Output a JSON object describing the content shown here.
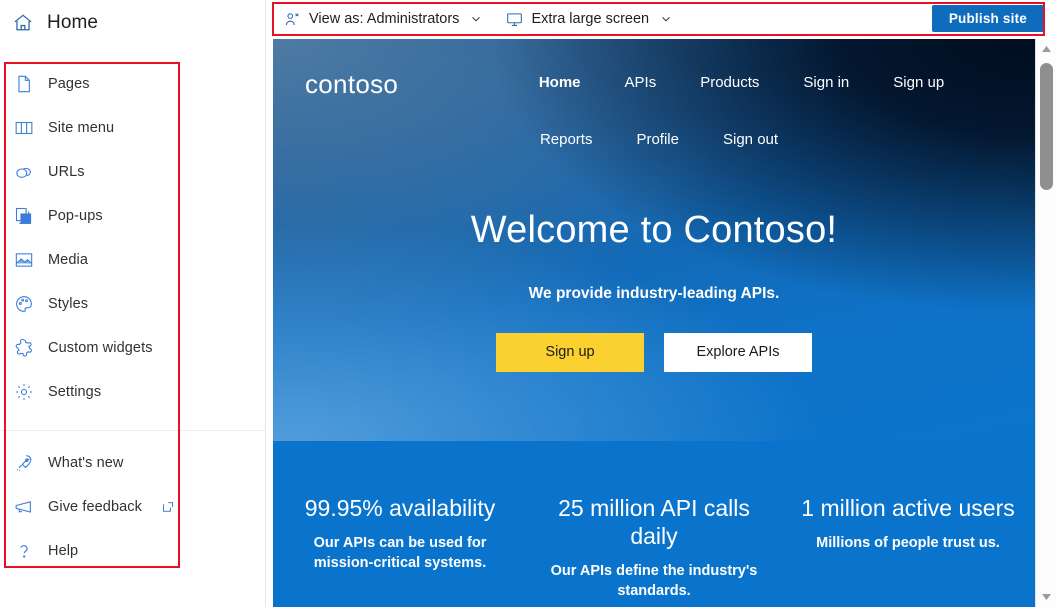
{
  "page_title": "Home",
  "sidebar": {
    "header": {
      "icon": "home-icon",
      "label": "Home"
    },
    "primary_items": [
      {
        "label": "Pages",
        "icon": "page-icon"
      },
      {
        "label": "Site menu",
        "icon": "menu-book-icon"
      },
      {
        "label": "URLs",
        "icon": "link-icon"
      },
      {
        "label": "Pop-ups",
        "icon": "copy-icon"
      },
      {
        "label": "Media",
        "icon": "image-icon"
      },
      {
        "label": "Styles",
        "icon": "palette-icon"
      },
      {
        "label": "Custom widgets",
        "icon": "puzzle-icon"
      },
      {
        "label": "Settings",
        "icon": "gear-icon"
      }
    ],
    "secondary_items": [
      {
        "label": "What's new",
        "icon": "rocket-icon",
        "external": false
      },
      {
        "label": "Give feedback",
        "icon": "megaphone-icon",
        "external": true
      },
      {
        "label": "Help",
        "icon": "question-icon",
        "external": false
      }
    ]
  },
  "toolbar": {
    "view_as": {
      "icon": "people-icon",
      "label": "View as: Administrators",
      "chevron": "chevron-down-icon"
    },
    "screen_size": {
      "icon": "monitor-icon",
      "label": "Extra large screen",
      "chevron": "chevron-down-icon"
    },
    "publish_label": "Publish site"
  },
  "preview": {
    "logo": "contoso",
    "nav_row_1": [
      {
        "label": "Home",
        "active": true
      },
      {
        "label": "APIs",
        "active": false
      },
      {
        "label": "Products",
        "active": false
      },
      {
        "label": "Sign in",
        "active": false
      },
      {
        "label": "Sign up",
        "active": false
      }
    ],
    "nav_row_2": [
      {
        "label": "Reports",
        "active": false
      },
      {
        "label": "Profile",
        "active": false
      },
      {
        "label": "Sign out",
        "active": false
      }
    ],
    "hero": {
      "title": "Welcome to Contoso!",
      "subtitle": "We provide industry-leading APIs.",
      "primary_cta": "Sign up",
      "secondary_cta": "Explore APIs"
    },
    "stats": [
      {
        "heading": "99.95% availability",
        "body": "Our APIs can be used for mission-critical systems."
      },
      {
        "heading": "25 million API calls daily",
        "body": "Our APIs define the industry's standards."
      },
      {
        "heading": "1 million active users",
        "body": "Millions of people trust us."
      }
    ]
  },
  "colors": {
    "accent_blue": "#0f6cbd",
    "annotation_red": "#e81123",
    "hero_blue": "#0a74cc",
    "cta_yellow": "#fbd130",
    "icon_blue": "#0f6cbd"
  }
}
